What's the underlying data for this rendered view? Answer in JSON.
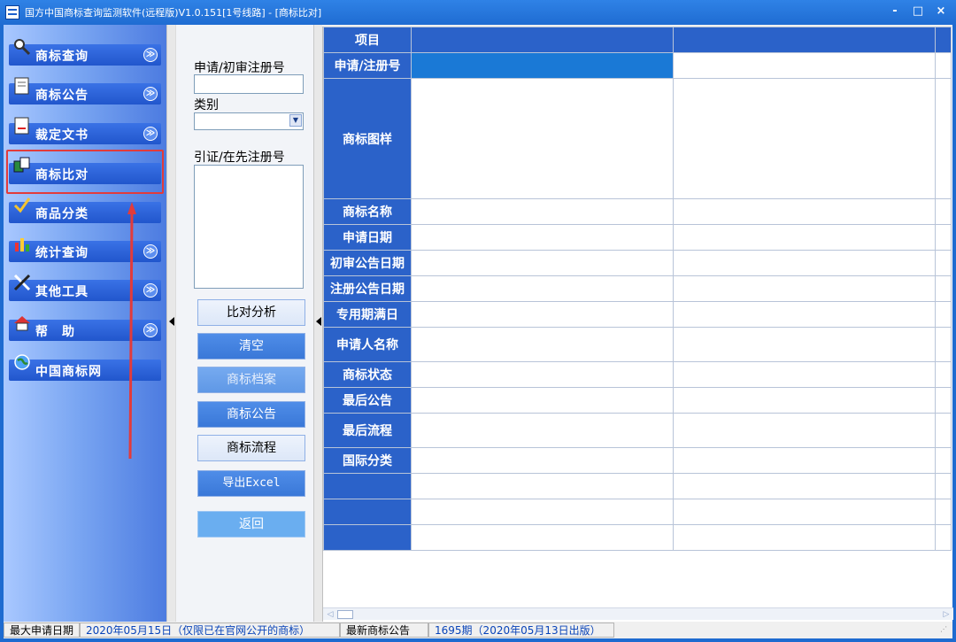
{
  "window": {
    "title": "国方中国商标查询监测软件(远程版)V1.0.151[1号线路] - [商标比对]",
    "minimize": "-",
    "maximize": "□",
    "close": "×"
  },
  "sidebar": {
    "items": [
      {
        "label": "商标查询",
        "icon": "magnifier-icon",
        "expandable": true
      },
      {
        "label": "商标公告",
        "icon": "document-icon",
        "expandable": true
      },
      {
        "label": "裁定文书",
        "icon": "file-icon",
        "expandable": true
      },
      {
        "label": "商标比对",
        "icon": "compare-icon",
        "expandable": false,
        "selected": true
      },
      {
        "label": "商品分类",
        "icon": "classify-icon",
        "expandable": false
      },
      {
        "label": "统计查询",
        "icon": "chart-icon",
        "expandable": true
      },
      {
        "label": "其他工具",
        "icon": "tools-icon",
        "expandable": true
      },
      {
        "label": "帮　助",
        "icon": "help-icon",
        "expandable": true
      },
      {
        "label": "中国商标网",
        "icon": "globe-icon",
        "expandable": false
      }
    ],
    "expand_glyph": "≫"
  },
  "form": {
    "reg_no_label": "申请/初审注册号",
    "reg_no_value": "",
    "category_label": "类别",
    "category_value": "",
    "cited_label": "引证/在先注册号",
    "cited_value": ""
  },
  "buttons": {
    "compare": "比对分析",
    "clear": "清空",
    "archive": "商标档案",
    "announcement": "商标公告",
    "process": "商标流程",
    "export": "导出Excel",
    "back": "返回"
  },
  "grid": {
    "rows": [
      "项目",
      "申请/注册号",
      "商标图样",
      "商标名称",
      "申请日期",
      "初审公告日期",
      "注册公告日期",
      "专用期满日",
      "申请人名称",
      "商标状态",
      "最后公告",
      "最后流程",
      "国际分类",
      "",
      "",
      ""
    ]
  },
  "statusbar": {
    "max_date_label": "最大申请日期",
    "max_date_value": "2020年05月15日（仅限已在官网公开的商标）",
    "latest_label": "最新商标公告",
    "latest_value": "1695期（2020年05月13日出版）"
  },
  "colors": {
    "title_bar": "#1f6cd2",
    "row_header": "#2b62c9",
    "selected_cell": "#1a79d6",
    "highlight_box": "#e23b3b"
  }
}
